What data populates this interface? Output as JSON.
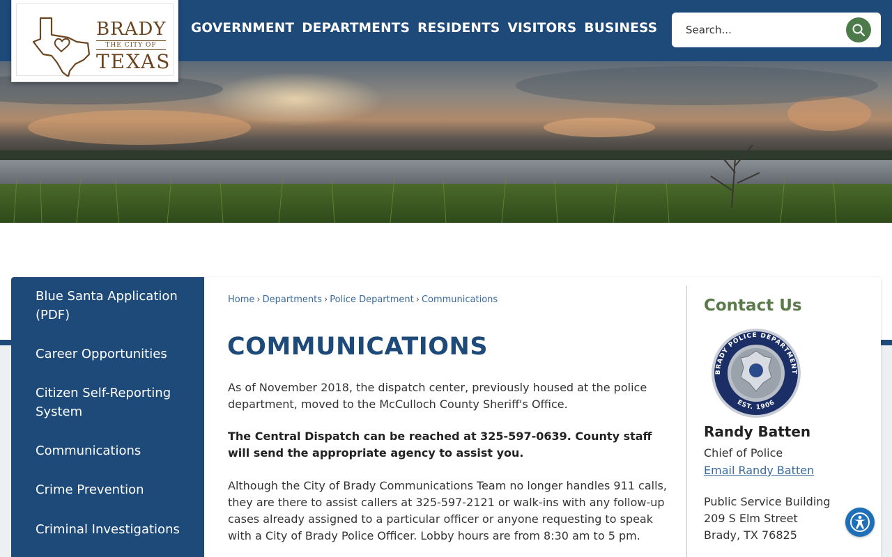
{
  "logo": {
    "brady": "BRADY",
    "city": "THE CITY OF",
    "texas": "TEXAS"
  },
  "nav": {
    "items": [
      "GOVERNMENT",
      "DEPARTMENTS",
      "RESIDENTS",
      "VISITORS",
      "BUSINESS"
    ]
  },
  "search": {
    "placeholder": "Search..."
  },
  "sidebar": {
    "items": [
      "Blue Santa Application (PDF)",
      "Career Opportunities",
      "Citizen Self-Reporting System",
      "Communications",
      "Crime Prevention",
      "Criminal Investigations"
    ]
  },
  "breadcrumb": {
    "home": "Home",
    "departments": "Departments",
    "police": "Police Department",
    "current": "Communications"
  },
  "main": {
    "title": "COMMUNICATIONS",
    "p1": "As of November 2018, the dispatch center, previously housed at the police department, moved to the McCulloch County Sheriff's Office.",
    "p2": "The Central Dispatch can be reached at 325-597-0639. County staff will send the appropriate agency to assist you.",
    "p3": "Although the City of Brady Communications Team no longer handles 911 calls, they are there to assist callers at 325-597-2121 or walk-ins with any follow-up cases already assigned to a particular officer or anyone requesting to speak with a City of Brady Police Officer. Lobby hours are from 8:30 am to 5 pm."
  },
  "contact": {
    "title": "Contact Us",
    "badge_text_top": "BRADY POLICE DEPARTMENT",
    "badge_text_bottom": "EST. 1906",
    "name": "Randy Batten",
    "role": "Chief of Police",
    "email_label": "Email Randy Batten",
    "building": "Public Service Building",
    "street": "209 S Elm Street",
    "city": "Brady, TX 76825"
  },
  "colors": {
    "primary_blue": "#1e4a7a",
    "accent_green": "#5a7a4a",
    "link_blue": "#3a6a9e"
  }
}
